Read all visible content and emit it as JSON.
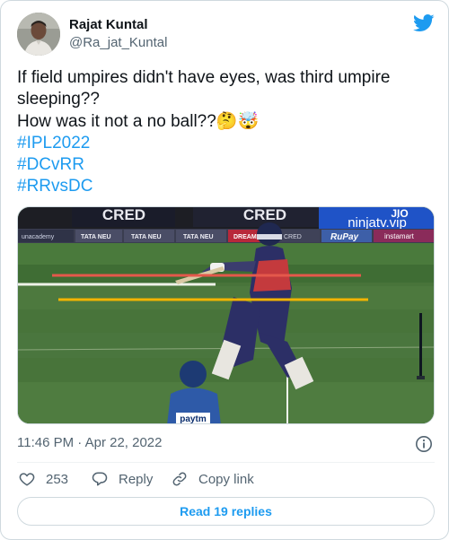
{
  "author": {
    "name": "Rajat Kuntal",
    "handle": "@Ra_jat_Kuntal"
  },
  "tweet": {
    "lines": [
      "If field umpires didn't have eyes, was third umpire",
      "sleeping??",
      "How was it not a no ball??🤔🤯"
    ],
    "hashtags": [
      "#IPL2022",
      "#DCvRR",
      "#RRvsDC"
    ]
  },
  "media": {
    "scoreboard_texts": {
      "left_logo": "CRED",
      "center_logo": "CRED",
      "sponsor_top": "JIO",
      "sponsor_url": "ninjatv.vip",
      "board_1": "unacademy",
      "board_2": "TATA NEU",
      "board_3": "TATA NEU",
      "board_4": "TATA NEU",
      "board_5": "DREAM11",
      "board_6": "CRED",
      "board_7": "RuPay",
      "board_8": "instamart",
      "fielder_sponsor": "paytm"
    }
  },
  "timestamp": "11:46 PM · Apr 22, 2022",
  "actions": {
    "likes": "253",
    "reply_label": "Reply",
    "copy_link_label": "Copy link"
  },
  "read_replies_label": "Read 19 replies",
  "colors": {
    "link_blue": "#1d9bf0",
    "text_primary": "#0f1419",
    "text_secondary": "#536471",
    "border": "#cfd9de",
    "overlay_red": "#e4584b",
    "overlay_yellow": "#f2b400"
  }
}
